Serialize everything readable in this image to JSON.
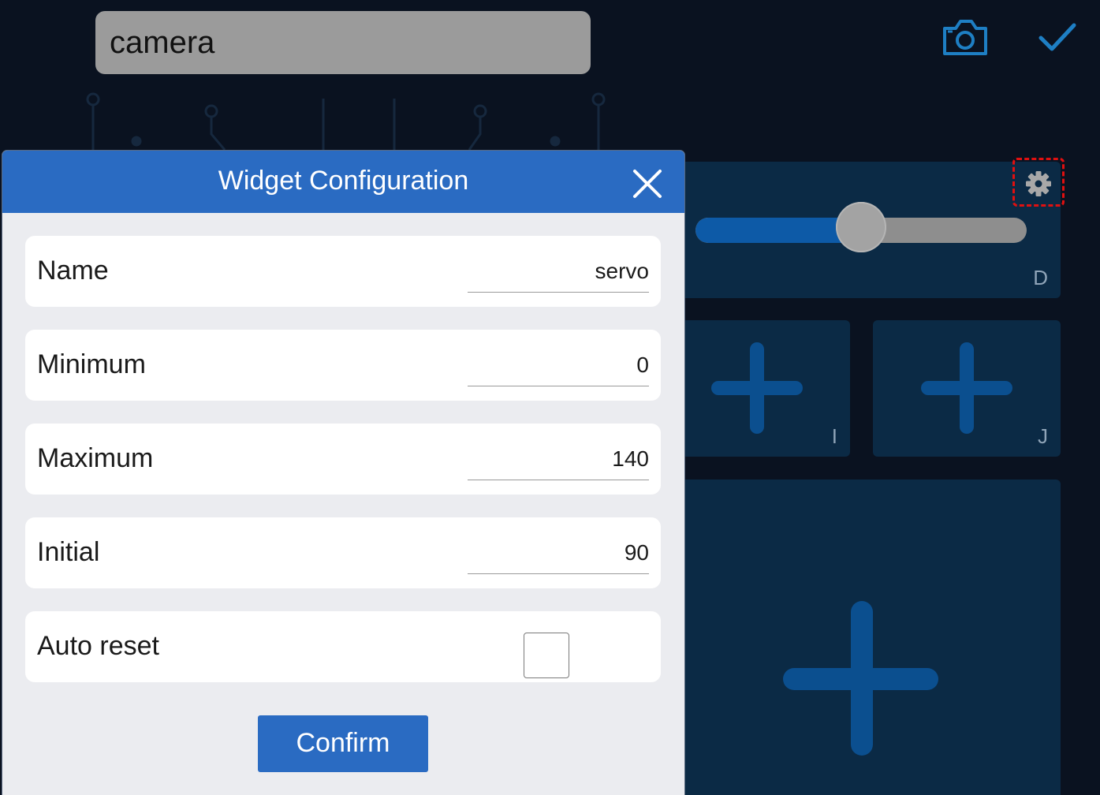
{
  "app": {
    "title_field_value": "camera",
    "camera_icon": "camera-icon",
    "done_icon": "checkmark-icon"
  },
  "widgets": {
    "slider_panel": {
      "letter": "D",
      "value_fraction": 0.5,
      "settings_icon": "gear-icon"
    },
    "button_panel_i": {
      "letter": "I",
      "icon": "plus-icon"
    },
    "button_panel_j": {
      "letter": "J",
      "icon": "plus-icon"
    },
    "large_panel": {
      "icon": "plus-icon"
    }
  },
  "dialog": {
    "title": "Widget Configuration",
    "close_icon": "close-icon",
    "fields": {
      "name": {
        "label": "Name",
        "value": "servo"
      },
      "minimum": {
        "label": "Minimum",
        "value": "0"
      },
      "maximum": {
        "label": "Maximum",
        "value": "140"
      },
      "initial": {
        "label": "Initial",
        "value": "90"
      }
    },
    "auto_reset": {
      "label": "Auto reset",
      "checked": false
    },
    "confirm_label": "Confirm"
  },
  "colors": {
    "background": "#0a1220",
    "panel": "#0b2a45",
    "accent": "#2a6bc2",
    "plus": "#0b4f8f",
    "highlight": "#e01010"
  }
}
